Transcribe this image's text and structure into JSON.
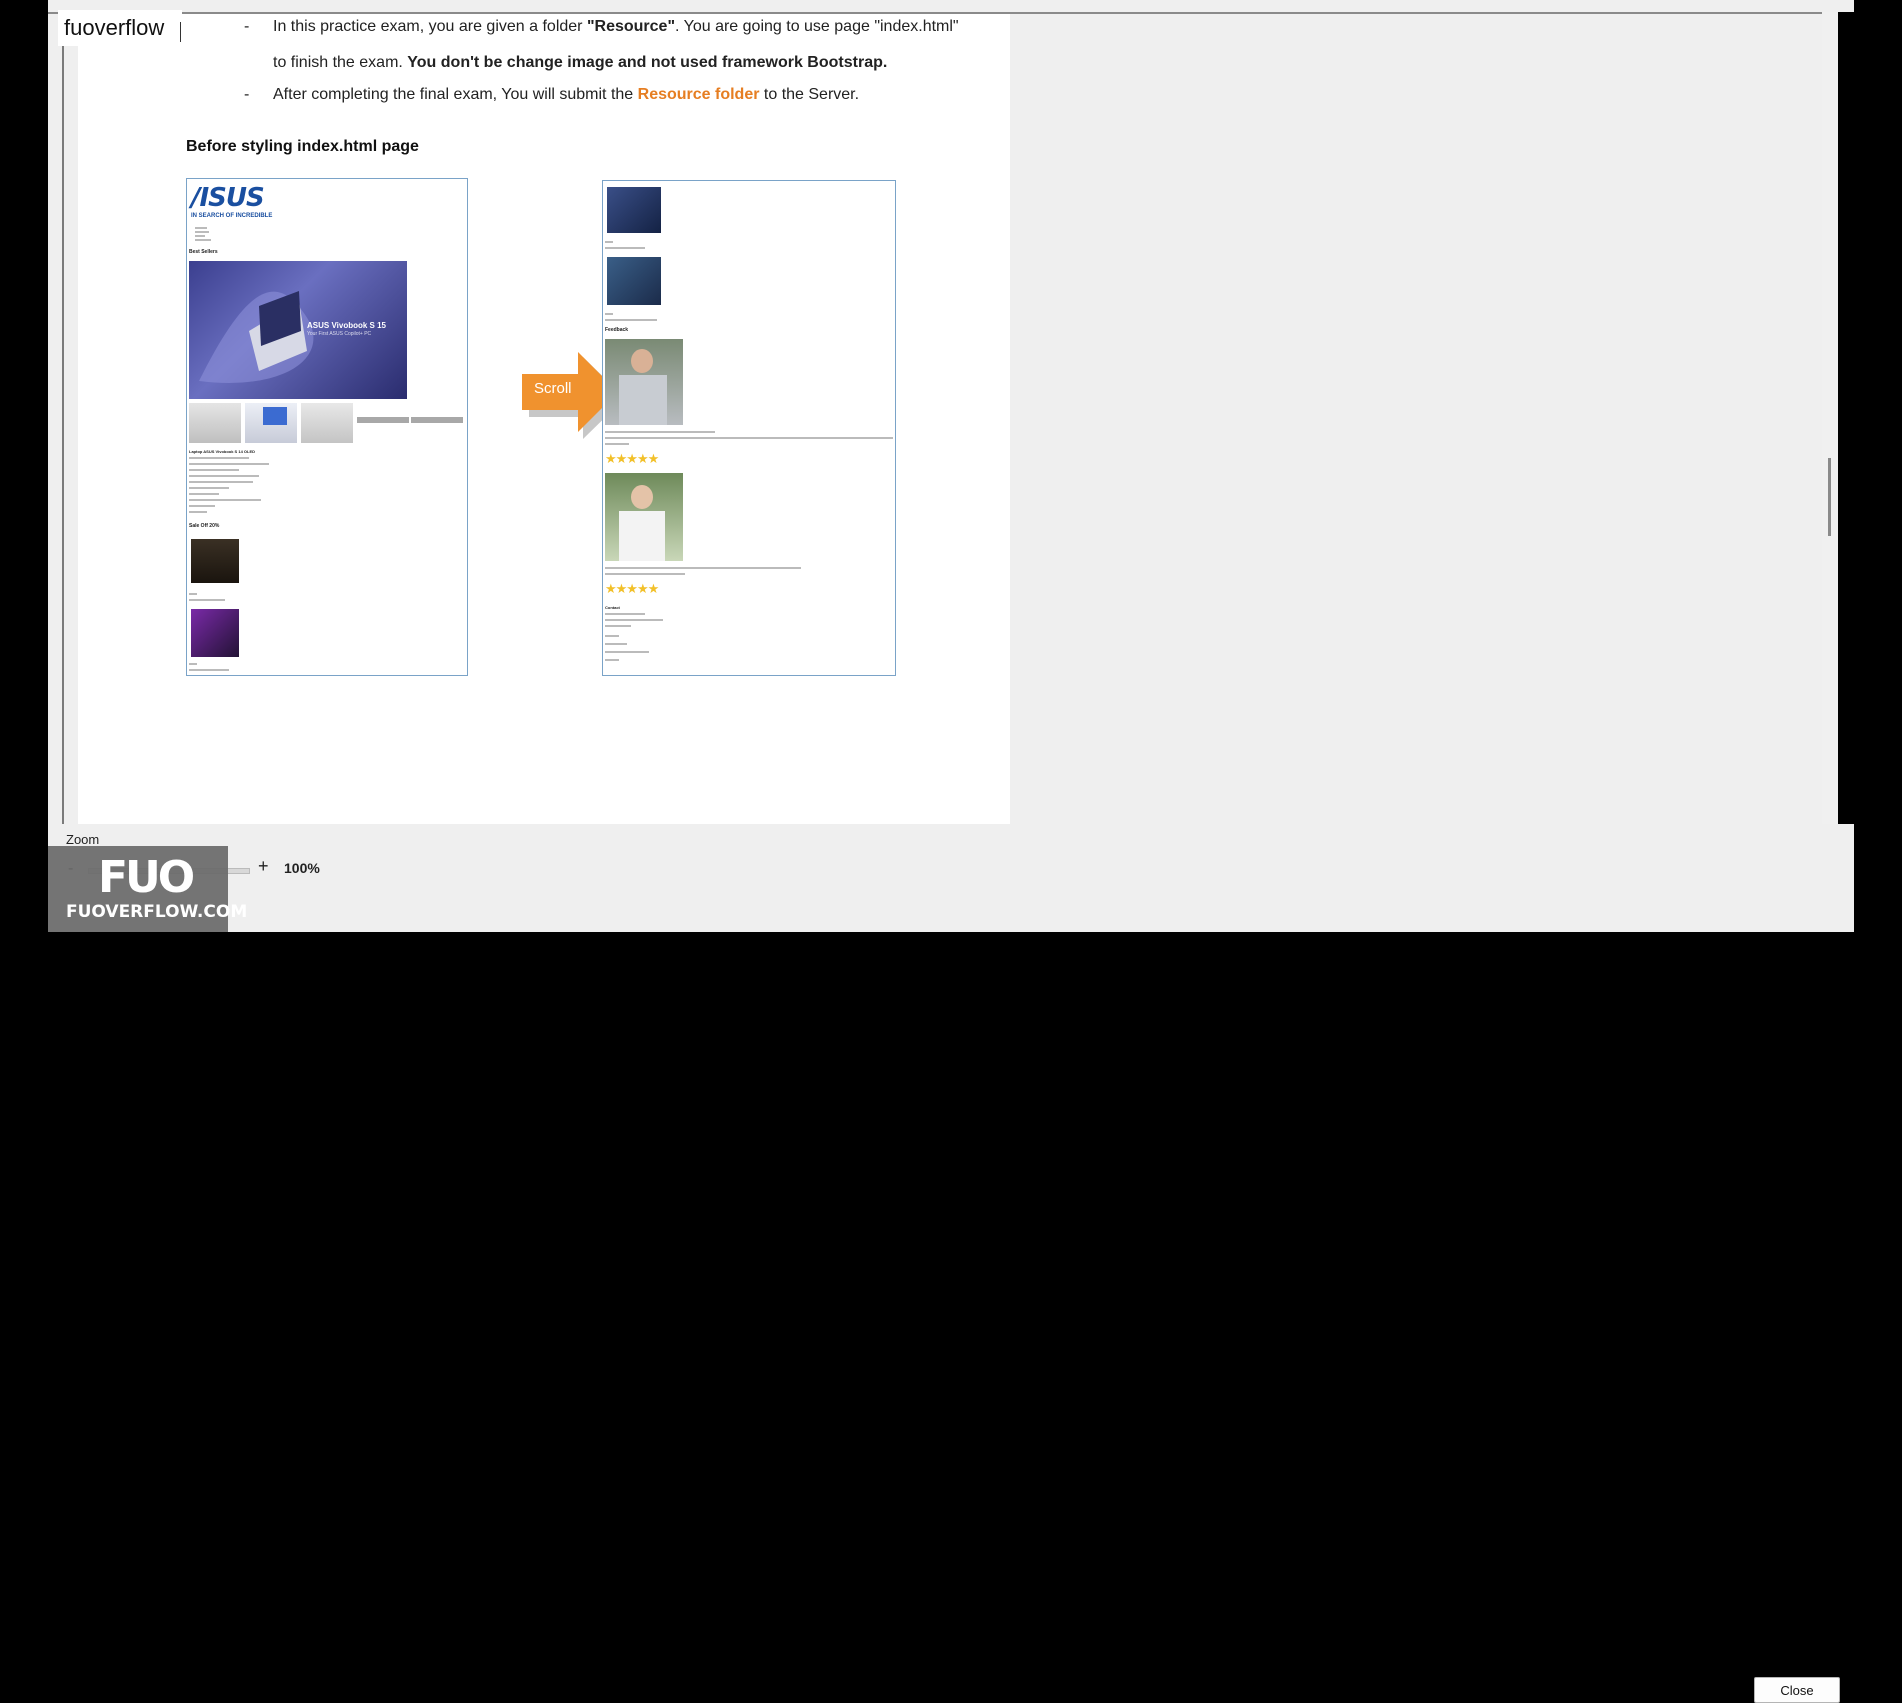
{
  "document": {
    "bullet1_line1_prefix": "In this practice exam, you are given a folder ",
    "bullet1_line1_folder": "\"Resource\"",
    "bullet1_line1_suffix": ". You are going to use page \"index.html\"",
    "bullet1_line2_plain": "to finish the exam. ",
    "bullet1_line2_bold": "You don't be change image and not used framework Bootstrap.",
    "bullet2_prefix": "After completing the final exam, You will submit the ",
    "bullet2_highlight": "Resource folder",
    "bullet2_suffix": " to the Server.",
    "dash": "-",
    "heading": "Before styling index.html page"
  },
  "left_preview": {
    "logo": "/ISUS",
    "tagline": "IN SEARCH OF INCREDIBLE",
    "section_best": "Best Sellers",
    "banner_title": "ASUS Vivobook S 15",
    "banner_sub": "Your First ASUS Copilot+ PC",
    "product_title": "Laptop ASUS Vivobook S 14 OLED",
    "section_sale": "Sale Off 20%"
  },
  "right_preview": {
    "section_feedback": "Feedback",
    "stars": "★★★★★",
    "contact": "Contact"
  },
  "arrow": {
    "label": "Scroll",
    "color": "#f0922e"
  },
  "footer": {
    "zoom_label": "Zoom",
    "zoom_minus": "-",
    "zoom_plus": "+",
    "zoom_value": "100%",
    "close_label": "Close"
  },
  "watermark": {
    "tag_text": "fuoverflow",
    "logo_text": "FUO",
    "site_text": "FUOVERFLOW.COM"
  }
}
